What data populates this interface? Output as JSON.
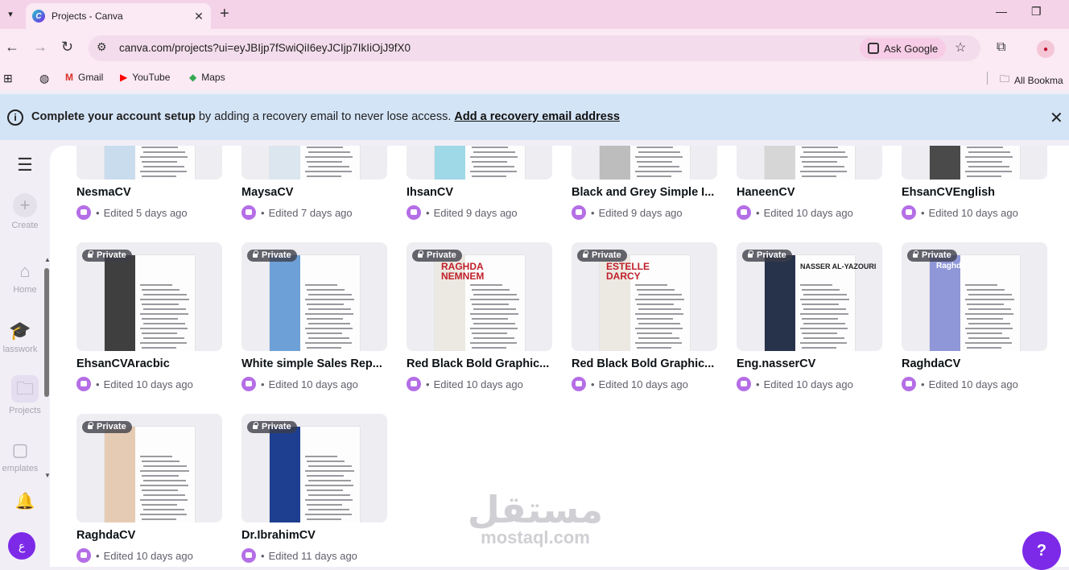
{
  "browser": {
    "tab_title": "Projects - Canva",
    "url": "canva.com/projects?ui=eyJBIjp7fSwiQiI6eyJCIjp7IkIiOjJ9fX0",
    "ask_google": "Ask Google",
    "bookmarks": [
      {
        "label": "Gmail",
        "icon": "gmail-icon"
      },
      {
        "label": "YouTube",
        "icon": "youtube-icon"
      },
      {
        "label": "Maps",
        "icon": "maps-icon"
      }
    ],
    "all_bookmarks": "All Bookma"
  },
  "banner": {
    "bold": "Complete your account setup",
    "text": " by adding a recovery email to never lose access. ",
    "link": "Add a recovery email address"
  },
  "sidebar": {
    "create": "Create",
    "home": "Home",
    "classwork": "lasswork",
    "projects": "Projects",
    "templates": "emplates"
  },
  "private_label": "Private",
  "projects_row1": [
    {
      "name": "NesmaCV",
      "edited": "Edited 5 days ago",
      "bar": "#c9dced"
    },
    {
      "name": "MaysaCV",
      "edited": "Edited 7 days ago",
      "bar": "#dbe6ef"
    },
    {
      "name": "IhsanCV",
      "edited": "Edited 9 days ago",
      "bar": "#9fd8e6"
    },
    {
      "name": "Black and Grey Simple I...",
      "edited": "Edited 9 days ago",
      "bar": "#bdbdbd"
    },
    {
      "name": "HaneenCV",
      "edited": "Edited 10 days ago",
      "bar": "#d6d6d6"
    },
    {
      "name": "EhsanCVEnglish",
      "edited": "Edited 10 days ago",
      "bar": "#4a4a4a"
    }
  ],
  "projects_row2": [
    {
      "name": "EhsanCVAracbic",
      "edited": "Edited 10 days ago",
      "bar": "#3f3f3f"
    },
    {
      "name": "White simple Sales Rep...",
      "edited": "Edited 10 days ago",
      "bar": "#6ea0d8"
    },
    {
      "name": "Red Black Bold Graphic...",
      "edited": "Edited 10 days ago",
      "bar": "#ece9e2",
      "headline": "RAGHDA NEMNEM"
    },
    {
      "name": "Red Black Bold Graphic...",
      "edited": "Edited 10 days ago",
      "bar": "#ece9e2",
      "headline": "ESTELLE DARCY"
    },
    {
      "name": "Eng.nasserCV",
      "edited": "Edited 10 days ago",
      "bar": "#27334a",
      "headline": "NASSER AL-YAZOURI"
    },
    {
      "name": "RaghdaCV",
      "edited": "Edited 10 days ago",
      "bar": "#8f97d8",
      "headline": "Raghda"
    }
  ],
  "projects_row3": [
    {
      "name": "RaghdaCV",
      "edited": "Edited 10 days ago",
      "bar": "#e6cbb4"
    },
    {
      "name": "Dr.IbrahimCV",
      "edited": "Edited 11 days ago",
      "bar": "#1e3f8f"
    }
  ],
  "watermark": {
    "arabic": "مستقل",
    "latin": "mostaql.com"
  },
  "help": "?",
  "colors": {
    "accent": "#7d2ae8",
    "banner": "#d4e4f7"
  }
}
